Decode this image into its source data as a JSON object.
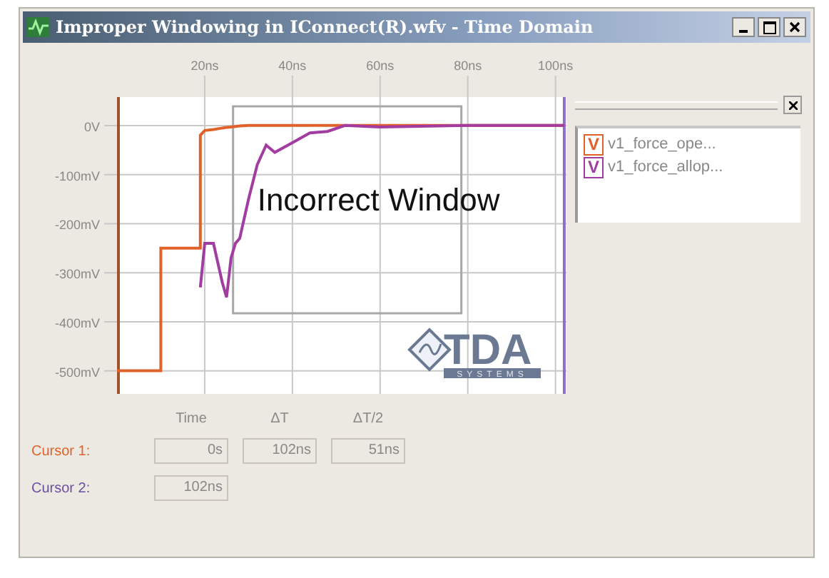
{
  "window": {
    "title": "Improper Windowing in IConnect(R).wfv - Time Domain"
  },
  "plot": {
    "chart_data": {
      "type": "line",
      "xlim": [
        0,
        102.5
      ],
      "ylim": [
        -547,
        58
      ],
      "xticks": [
        {
          "value": 20,
          "label": "20ns"
        },
        {
          "value": 40,
          "label": "40ns"
        },
        {
          "value": 60,
          "label": "60ns"
        },
        {
          "value": 80,
          "label": "80ns"
        },
        {
          "value": 100,
          "label": "100ns"
        }
      ],
      "yticks": [
        {
          "value": 0,
          "label": "0V"
        },
        {
          "value": -100,
          "label": "-100mV"
        },
        {
          "value": -200,
          "label": "-200mV"
        },
        {
          "value": -300,
          "label": "-300mV"
        },
        {
          "value": -400,
          "label": "-400mV"
        },
        {
          "value": -500,
          "label": "-500mV"
        }
      ],
      "x": [
        0,
        10,
        10,
        19,
        19,
        20,
        22,
        24,
        25,
        26,
        27,
        28,
        30,
        32,
        34,
        36,
        40,
        44,
        48,
        52,
        60,
        80,
        102
      ],
      "series": [
        {
          "name": "v1_force_ope...",
          "color": "#e0622a",
          "values": [
            -500,
            -500,
            -250,
            -250,
            -20,
            -10,
            -8,
            -5,
            -4,
            -3,
            -2,
            -1,
            0,
            0,
            0,
            0,
            0,
            0,
            0,
            0,
            0,
            0,
            0
          ]
        },
        {
          "name": "v1_force_allop...",
          "color": "#a33ca0",
          "values": [
            null,
            null,
            null,
            null,
            -330,
            -240,
            -240,
            -320,
            -350,
            -270,
            -240,
            -230,
            -150,
            -80,
            -40,
            -55,
            -35,
            -15,
            -12,
            0,
            -3,
            0,
            0
          ]
        }
      ],
      "grid": true,
      "annotations": [
        {
          "text": "Incorrect Window",
          "x": 32,
          "y": -150
        }
      ]
    },
    "logo": {
      "text": "TDA",
      "subtext": "SYSTEMS"
    }
  },
  "legend": {
    "items": [
      {
        "badge": "V"
      },
      {
        "badge": "V"
      }
    ]
  },
  "cursors": {
    "columns": [
      "Time",
      "ΔT",
      "ΔT/2"
    ],
    "rows": [
      {
        "label": "Cursor 1:",
        "color": "#e0622a",
        "values": [
          "0s",
          "102ns",
          "51ns"
        ]
      },
      {
        "label": "Cursor 2:",
        "color": "#6a4fa0",
        "values": [
          "102ns"
        ]
      }
    ]
  }
}
